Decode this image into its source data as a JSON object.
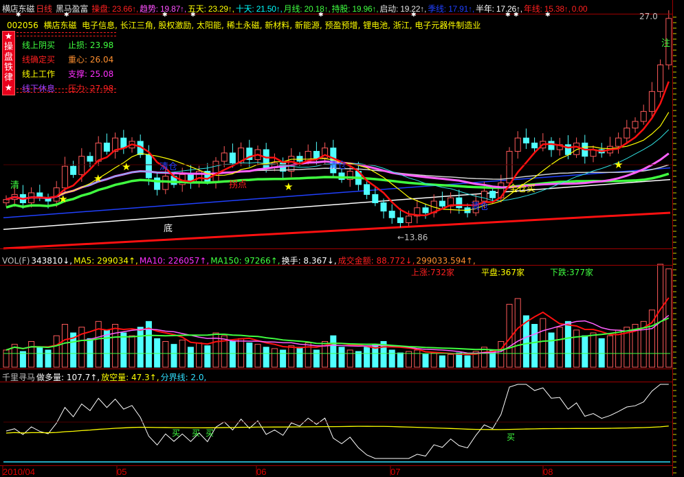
{
  "title": {
    "stock_name": "横店东磁",
    "period": "日线",
    "indicator": "黑马盈富"
  },
  "header_values": [
    {
      "label": "操盘",
      "value": "23.66",
      "arrow": "↑",
      "color": "#ff2020"
    },
    {
      "label": "趋势",
      "value": "19.87",
      "arrow": "↑",
      "color": "#ff50ff"
    },
    {
      "label": "五天",
      "value": "23.29",
      "arrow": "↑",
      "color": "#ffff00"
    },
    {
      "label": "十天",
      "value": "21.50",
      "arrow": "↑",
      "color": "#00ffff"
    },
    {
      "label": "月线",
      "value": "20.18",
      "arrow": "↑",
      "color": "#40ff40"
    },
    {
      "label": "持股",
      "value": "19.96",
      "arrow": "↑",
      "color": "#40ff40"
    },
    {
      "label": "启动",
      "value": "19.22",
      "arrow": "↑",
      "color": "#e0e0e0"
    },
    {
      "label": "季线",
      "value": "17.91",
      "arrow": "↑",
      "color": "#2040ff"
    },
    {
      "label": "半年",
      "value": "17.26",
      "arrow": "↑",
      "color": "#ffffff"
    },
    {
      "label": "年线",
      "value": "15.38",
      "arrow": "↑",
      "color": "#ff2020"
    },
    {
      "label": "",
      "value": "0.00",
      "arrow": "",
      "color": "#ff2020"
    }
  ],
  "info_line": {
    "code": "002056",
    "name": "横店东磁",
    "concepts": "电子信息, 长江三角, 股权激励, 太阳能, 稀土永磁, 新材料, 新能源, 预盈预增, 锂电池, 浙江, 电子元器件制造业"
  },
  "badge": [
    "★",
    "操",
    "盘",
    "铁",
    "律",
    "★"
  ],
  "legend": [
    {
      "left": "线上阴买",
      "left_color": "#40ff40",
      "right": "止损: 23.98",
      "right_color": "#40ff40"
    },
    {
      "left": "线确定买",
      "left_color": "#ff2020",
      "right": "重心: 26.04",
      "right_color": "#ff9030"
    },
    {
      "left": "线上工作",
      "left_color": "#ffff00",
      "right": "支撑: 25.08",
      "right_color": "#ff30ff"
    },
    {
      "left": "线下休息",
      "left_color": "#a040ff",
      "right": "压力: 27.98",
      "right_color": "#ff2020"
    }
  ],
  "annotations": {
    "bottom": "底",
    "turn": "拐点",
    "clear1": "清仓",
    "clear2": "清仓",
    "clear3": "清仓",
    "full_buy": "全仓买",
    "watch": "注",
    "qing": "清",
    "low_price": "13.86",
    "high_price": "27.0"
  },
  "chart_data": {
    "type": "candlestick",
    "price_range": [
      13.86,
      27.0
    ],
    "closes": [
      15.9,
      16.2,
      15.7,
      16.3,
      16.0,
      15.8,
      16.6,
      17.9,
      17.4,
      18.5,
      18.2,
      19.3,
      18.8,
      19.6,
      19.0,
      19.4,
      18.6,
      17.2,
      16.5,
      17.3,
      16.8,
      17.4,
      16.9,
      17.6,
      17.0,
      18.2,
      18.7,
      18.1,
      19.0,
      18.3,
      18.9,
      17.8,
      18.1,
      17.6,
      18.5,
      18.2,
      18.8,
      18.4,
      19.0,
      17.5,
      17.1,
      17.6,
      16.8,
      16.2,
      15.7,
      15.2,
      14.8,
      14.5,
      14.9,
      15.4,
      15.1,
      15.8,
      15.5,
      16.0,
      15.4,
      15.1,
      15.8,
      16.4,
      16.0,
      16.9,
      18.8,
      19.6,
      19.3,
      19.0,
      19.4,
      18.9,
      19.2,
      18.6,
      19.3,
      18.5,
      18.9,
      18.7,
      19.1,
      19.6,
      20.2,
      20.6,
      21.2,
      22.4,
      24.0,
      26.8
    ],
    "volumes": [
      60000,
      80000,
      55000,
      90000,
      70000,
      60000,
      110000,
      150000,
      120000,
      140000,
      100000,
      160000,
      130000,
      150000,
      120000,
      110000,
      140000,
      160000,
      100000,
      90000,
      80000,
      95000,
      70000,
      85000,
      75000,
      120000,
      110000,
      90000,
      100000,
      85000,
      80000,
      70000,
      65000,
      60000,
      75000,
      70000,
      85000,
      60000,
      90000,
      110000,
      70000,
      60000,
      55000,
      70000,
      80000,
      90000,
      60000,
      50000,
      55000,
      60000,
      45000,
      50000,
      40000,
      45000,
      50000,
      40000,
      55000,
      70000,
      60000,
      90000,
      220000,
      240000,
      180000,
      150000,
      170000,
      120000,
      140000,
      160000,
      130000,
      110000,
      120000,
      100000,
      110000,
      130000,
      140000,
      150000,
      160000,
      200000,
      360000,
      343810
    ],
    "long_lines": [
      {
        "name": "年线",
        "color": "#ff1010",
        "start": 12.95,
        "end": 15.1
      },
      {
        "name": "季线",
        "color": "#2040ff",
        "start": 14.8,
        "end": 17.8
      },
      {
        "name": "半年",
        "color": "#ffffff",
        "start": 14.1,
        "end": 17.1
      }
    ],
    "x_ticks": [
      "2010/04",
      "05",
      "06",
      "07",
      "08"
    ]
  },
  "volume_header": [
    {
      "text": "VOL(F)",
      "color": "#c0c0c0"
    },
    {
      "text": "343810↓,",
      "color": "#ffffff"
    },
    {
      "text": "MA5: 299034↑,",
      "color": "#ffff00"
    },
    {
      "text": "MA10: 226057↑,",
      "color": "#ff30ff"
    },
    {
      "text": "MA150: 97266↑,",
      "color": "#40ff40"
    },
    {
      "text": "换手: 8.367↓,",
      "color": "#ffffff"
    },
    {
      "text": "成交金额: 88.772↓,",
      "color": "#ff2020"
    },
    {
      "text": "299033.594↑,",
      "color": "#ff9030"
    }
  ],
  "market": {
    "up": "上涨:732家",
    "flat": "平盘:367家",
    "down": "下跌:377家"
  },
  "indicator_header": [
    {
      "text": "千里寻马",
      "color": "#c0c0c0"
    },
    {
      "text": "做多量: 107.7↑,",
      "color": "#ffffff"
    },
    {
      "text": "放空量: 47.3↑,",
      "color": "#ffff00"
    },
    {
      "text": "分界线: 2.0,",
      "color": "#30e0ff"
    }
  ],
  "buy_label": "买"
}
